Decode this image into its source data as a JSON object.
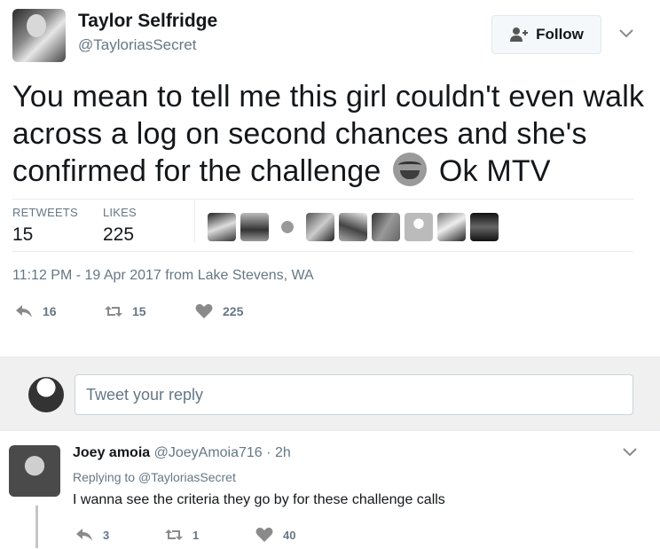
{
  "tweet": {
    "author_name": "Taylor Selfridge",
    "author_handle": "@TayloriasSecret",
    "follow_label": "Follow",
    "text_part1": "You mean to tell me this girl couldn't even walk across a log on second chances and she's confirmed for the challenge",
    "emoji": "face-with-tears-of-joy-emoji",
    "text_part2": "Ok MTV",
    "stats": {
      "retweets_label": "RETWEETS",
      "retweets_value": "15",
      "likes_label": "LIKES",
      "likes_value": "225"
    },
    "likers_count": 9,
    "meta": "11:12 PM - 19 Apr 2017 from Lake Stevens, WA",
    "actions": {
      "reply_count": "16",
      "retweet_count": "15",
      "like_count": "225"
    }
  },
  "composer": {
    "placeholder": "Tweet your reply"
  },
  "reply": {
    "name": "Joey amoia",
    "handle": "@JoeyAmoia716",
    "dot": "·",
    "time": "2h",
    "replying_prefix": "Replying to",
    "replying_handle": "@TayloriasSecret",
    "text": "I wanna see the criteria they go by for these challenge calls",
    "actions": {
      "reply_count": "3",
      "retweet_count": "1",
      "like_count": "40"
    }
  },
  "colors": {
    "text": "#14171a",
    "secondary": "#657786",
    "divider": "#e6ecf0",
    "reply_bar": "#f0f0f0",
    "icon": "#8a8a8a"
  }
}
